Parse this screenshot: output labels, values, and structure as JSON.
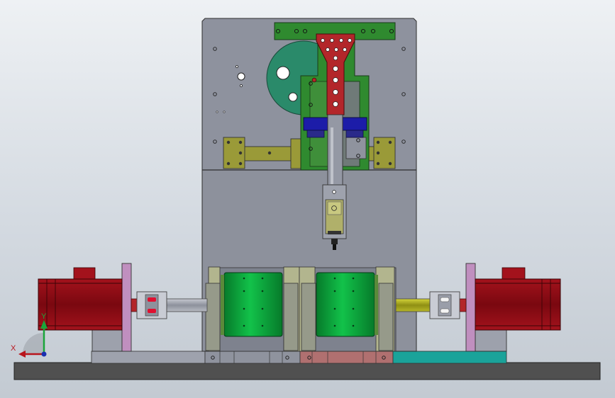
{
  "viewport": {
    "background_top": "#eef1f4",
    "background_bottom": "#c3cad2"
  },
  "colors": {
    "housing_gray": "#8f939f",
    "frame_green": "#2f8a2f",
    "arm_red": "#b3262a",
    "motor_red": "#8b0a12",
    "roller_green": "#0aa33a",
    "shaft_olive": "#a3a31e",
    "bracket_olive": "#9a9a38",
    "block_blue": "#1c1ca8",
    "teal_plate": "#1aa39a",
    "base_dark": "#4f4f4f",
    "support_pink": "#c08fbf"
  },
  "triad": {
    "x_label": "X",
    "y_label": "Y",
    "x_color": "#b8141c",
    "y_color": "#1aa53a"
  }
}
